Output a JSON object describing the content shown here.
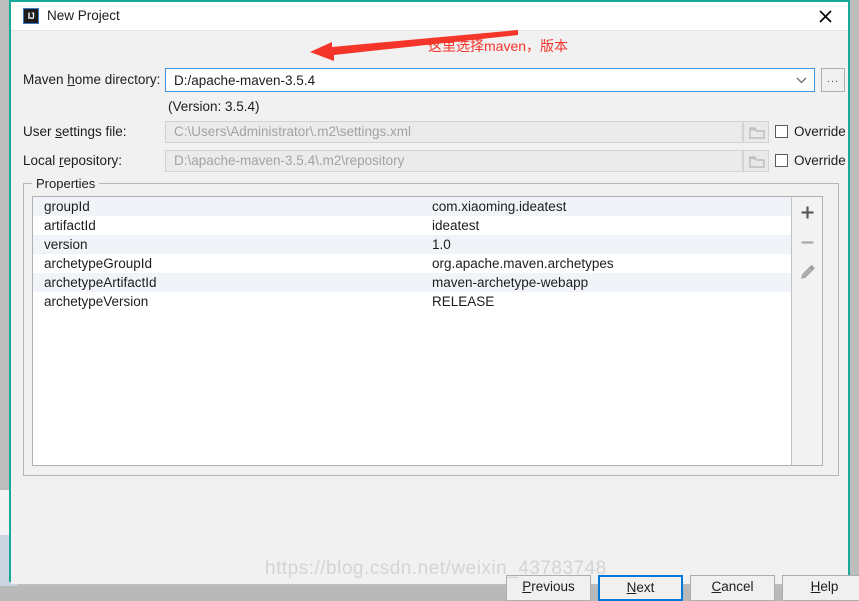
{
  "window": {
    "title": "New Project",
    "logo_text": "IJ",
    "close_label": "×",
    "accent_border": "#17a99a"
  },
  "form": {
    "maven_home": {
      "label_pre": "Maven ",
      "label_mnemonic": "h",
      "label_post": "ome directory:",
      "value": "D:/apache-maven-3.5.4",
      "browse_label": "...",
      "chevron_icon": "chevron-down-icon"
    },
    "version_note": "(Version: 3.5.4)",
    "user_settings": {
      "label_pre": "User ",
      "label_mnemonic": "s",
      "label_post": "ettings file:",
      "value": "C:\\Users\\Administrator\\.m2\\settings.xml",
      "override_label": "Override",
      "override_checked": false,
      "folder_icon": "folder-icon"
    },
    "local_repository": {
      "label_pre": "Local ",
      "label_mnemonic": "r",
      "label_post": "epository:",
      "value": "D:\\apache-maven-3.5.4\\.m2\\repository",
      "override_label": "Override",
      "override_checked": false,
      "folder_icon": "folder-icon"
    }
  },
  "properties": {
    "group_title": "Properties",
    "rows": [
      {
        "key": "groupId",
        "value": "com.xiaoming.ideatest"
      },
      {
        "key": "artifactId",
        "value": "ideatest"
      },
      {
        "key": "version",
        "value": "1.0"
      },
      {
        "key": "archetypeGroupId",
        "value": "org.apache.maven.archetypes"
      },
      {
        "key": "archetypeArtifactId",
        "value": "maven-archetype-webapp"
      },
      {
        "key": "archetypeVersion",
        "value": "RELEASE"
      }
    ],
    "toolbar": [
      {
        "name": "add-property-button",
        "icon": "plus-icon",
        "label": "+"
      },
      {
        "name": "remove-property-button",
        "icon": "minus-icon",
        "label": "−"
      },
      {
        "name": "edit-property-button",
        "icon": "pencil-icon",
        "label": "✎"
      }
    ]
  },
  "footer": {
    "previous": {
      "pre": "",
      "mnemonic": "P",
      "post": "revious"
    },
    "next": {
      "pre": "",
      "mnemonic": "N",
      "post": "ext"
    },
    "cancel": {
      "pre": "",
      "mnemonic": "C",
      "post": "ancel"
    },
    "help": {
      "pre": "",
      "mnemonic": "H",
      "post": "elp"
    }
  },
  "annotation": {
    "text": "这里选择maven，版本",
    "color": "#f5342a",
    "arrow_icon": "arrow-left-icon"
  },
  "watermark": "https://blog.csdn.net/weixin_43783748"
}
